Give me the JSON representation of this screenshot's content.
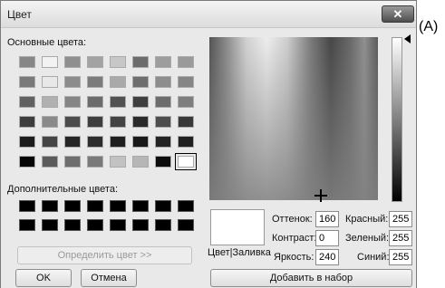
{
  "window": {
    "title": "Цвет",
    "close_label": "✕",
    "corner_label": "(A)"
  },
  "basic": {
    "label": "Основные цвета:",
    "rows": [
      [
        "#878787",
        "#f2f2f2",
        "#8f8f8f",
        "#a3a3a3",
        "#c7c7c7",
        "#6c6c6c",
        "#9d9d9d",
        "#9a9a9a"
      ],
      [
        "#7a7a7a",
        "#e8e8e8",
        "#8c8c8c",
        "#7b7b7b",
        "#a9a9a9",
        "#6e6e6e",
        "#8d8d8d",
        "#858585"
      ],
      [
        "#616161",
        "#b1b1b1",
        "#858585",
        "#6b6b6b",
        "#525252",
        "#3f3f3f",
        "#6d6d6d",
        "#7e7e7e"
      ],
      [
        "#3d3d3d",
        "#8a8a8a",
        "#4c4c4c",
        "#3e3e3e",
        "#434343",
        "#2a2a2a",
        "#4d4d4d",
        "#383838"
      ],
      [
        "#1c1c1c",
        "#454545",
        "#262626",
        "#2d2d2d",
        "#1f1f1f",
        "#181818",
        "#232323",
        "#202020"
      ],
      [
        "#050505",
        "#5b5b5b",
        "#6e6e6e",
        "#7a7a7a",
        "#c2c2c2",
        "#b6b6b6",
        "#0c0c0c",
        "#ffffff"
      ]
    ],
    "selected_index": [
      5,
      7
    ]
  },
  "custom": {
    "label": "Дополнительные цвета:",
    "rows": 2,
    "cols": 8
  },
  "buttons": {
    "define": "Определить цвет >>",
    "ok": "OK",
    "cancel": "Отмена",
    "add": "Добавить в набор"
  },
  "preview_label": "Цвет|Заливка",
  "fields": {
    "hue": {
      "label": "Оттенок:",
      "value": "160"
    },
    "sat": {
      "label": "Контраст:",
      "value": "0"
    },
    "lum": {
      "label": "Яркость:",
      "value": "240"
    },
    "red": {
      "label": "Красный:",
      "value": "255"
    },
    "green": {
      "label": "Зеленый:",
      "value": "255"
    },
    "blue": {
      "label": "Синий:",
      "value": "255"
    }
  }
}
